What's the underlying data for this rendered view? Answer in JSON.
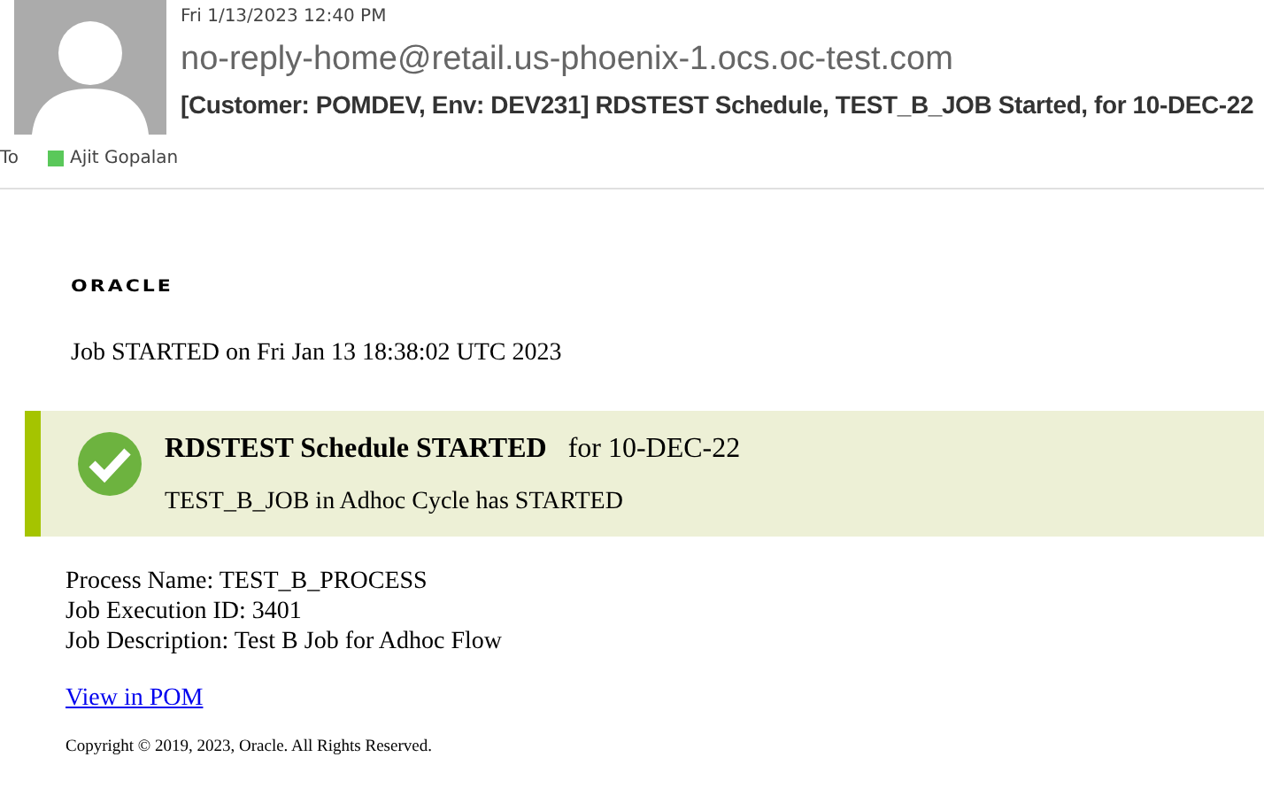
{
  "header": {
    "date": "Fri 1/13/2023 12:40 PM",
    "sender": "no-reply-home@retail.us-phoenix-1.ocs.oc-test.com",
    "subject": "[Customer: POMDEV, Env: DEV231] RDSTEST Schedule, TEST_B_JOB Started, for 10-DEC-22",
    "to_label": "To",
    "recipients": [
      {
        "name": "Ajit Gopalan",
        "color": "#5ac85a"
      }
    ]
  },
  "body": {
    "logo": "ORACLE",
    "started_line": "Job STARTED on Fri Jan 13 18:38:02 UTC 2023",
    "banner": {
      "kind": "success",
      "title": "RDSTEST Schedule STARTED",
      "title_suffix": "for 10-DEC-22",
      "message": "TEST_B_JOB in Adhoc Cycle has STARTED"
    },
    "details": [
      "Process Name: TEST_B_PROCESS",
      "Job Execution ID: 3401",
      "Job Description: Test B Job for Adhoc Flow"
    ],
    "link": "View in POM",
    "copyright": "Copyright © 2019, 2023, Oracle. All Rights Reserved."
  }
}
